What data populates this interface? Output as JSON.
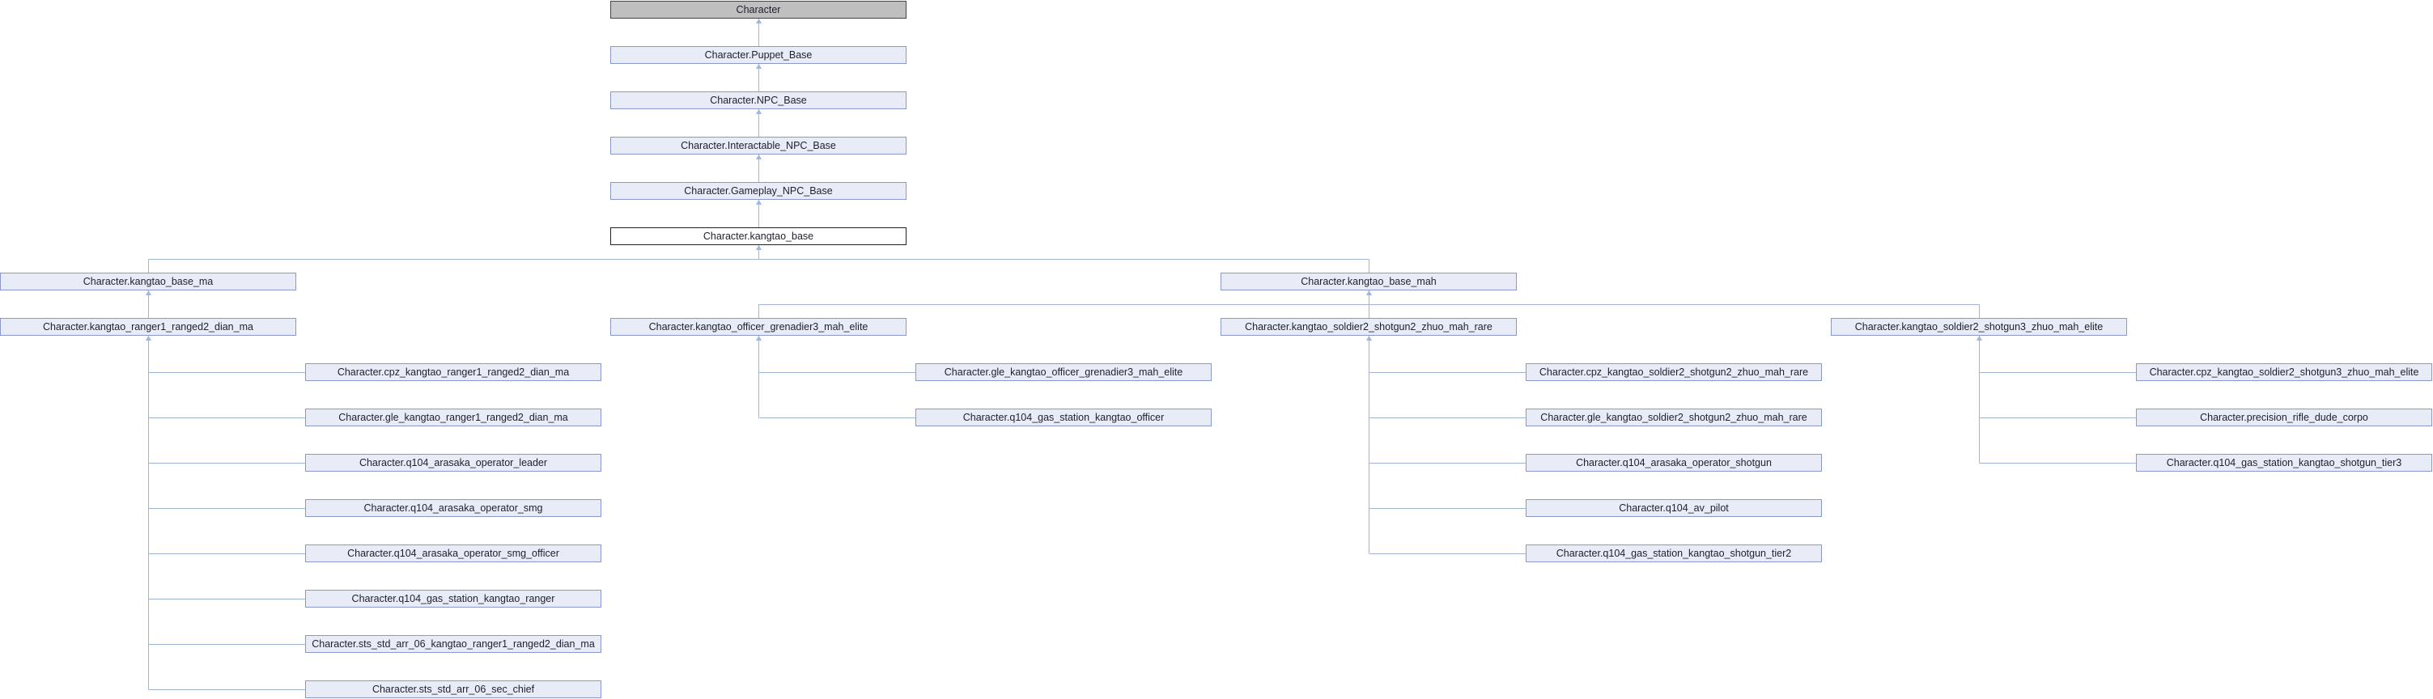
{
  "diagram": {
    "type": "class-inheritance-graph",
    "colors": {
      "node_fill": "#e8ecf6",
      "node_border": "#8a99c9",
      "edge": "#9fb6d8",
      "root_fill": "#bfbfbf",
      "focus_fill": "#ffffff"
    },
    "nodes": [
      {
        "id": "n0",
        "label": "Character",
        "style": "root"
      },
      {
        "id": "n1",
        "label": "Character.Puppet_Base"
      },
      {
        "id": "n2",
        "label": "Character.NPC_Base"
      },
      {
        "id": "n3",
        "label": "Character.Interactable_NPC_Base"
      },
      {
        "id": "n4",
        "label": "Character.Gameplay_NPC_Base"
      },
      {
        "id": "n5",
        "label": "Character.kangtao_base",
        "style": "focus"
      },
      {
        "id": "n6",
        "label": "Character.kangtao_base_ma"
      },
      {
        "id": "n7",
        "label": "Character.kangtao_base_mah"
      },
      {
        "id": "n8",
        "label": "Character.kangtao_ranger1_ranged2_dian_ma"
      },
      {
        "id": "n9",
        "label": "Character.kangtao_officer_grenadier3_mah_elite"
      },
      {
        "id": "n10",
        "label": "Character.kangtao_soldier2_shotgun2_zhuo_mah_rare"
      },
      {
        "id": "n11",
        "label": "Character.kangtao_soldier2_shotgun3_zhuo_mah_elite"
      },
      {
        "id": "n12",
        "label": "Character.cpz_kangtao_ranger1_ranged2_dian_ma"
      },
      {
        "id": "n13",
        "label": "Character.gle_kangtao_ranger1_ranged2_dian_ma"
      },
      {
        "id": "n14",
        "label": "Character.q104_arasaka_operator_leader"
      },
      {
        "id": "n15",
        "label": "Character.q104_arasaka_operator_smg"
      },
      {
        "id": "n16",
        "label": "Character.q104_arasaka_operator_smg_officer"
      },
      {
        "id": "n17",
        "label": "Character.q104_gas_station_kangtao_ranger"
      },
      {
        "id": "n18",
        "label": "Character.sts_std_arr_06_kangtao_ranger1_ranged2_dian_ma"
      },
      {
        "id": "n19",
        "label": "Character.sts_std_arr_06_sec_chief"
      },
      {
        "id": "n20",
        "label": "Character.gle_kangtao_officer_grenadier3_mah_elite"
      },
      {
        "id": "n21",
        "label": "Character.q104_gas_station_kangtao_officer"
      },
      {
        "id": "n22",
        "label": "Character.cpz_kangtao_soldier2_shotgun2_zhuo_mah_rare"
      },
      {
        "id": "n23",
        "label": "Character.gle_kangtao_soldier2_shotgun2_zhuo_mah_rare"
      },
      {
        "id": "n24",
        "label": "Character.q104_arasaka_operator_shotgun"
      },
      {
        "id": "n25",
        "label": "Character.q104_av_pilot"
      },
      {
        "id": "n26",
        "label": "Character.q104_gas_station_kangtao_shotgun_tier2"
      },
      {
        "id": "n27",
        "label": "Character.cpz_kangtao_soldier2_shotgun3_zhuo_mah_elite"
      },
      {
        "id": "n28",
        "label": "Character.precision_rifle_dude_corpo"
      },
      {
        "id": "n29",
        "label": "Character.q104_gas_station_kangtao_shotgun_tier3"
      }
    ],
    "edges": [
      [
        "n0",
        "n1"
      ],
      [
        "n1",
        "n2"
      ],
      [
        "n2",
        "n3"
      ],
      [
        "n3",
        "n4"
      ],
      [
        "n4",
        "n5"
      ],
      [
        "n5",
        "n6"
      ],
      [
        "n5",
        "n7"
      ],
      [
        "n6",
        "n8"
      ],
      [
        "n7",
        "n9"
      ],
      [
        "n7",
        "n10"
      ],
      [
        "n7",
        "n11"
      ],
      [
        "n8",
        "n12"
      ],
      [
        "n8",
        "n13"
      ],
      [
        "n8",
        "n14"
      ],
      [
        "n8",
        "n15"
      ],
      [
        "n8",
        "n16"
      ],
      [
        "n8",
        "n17"
      ],
      [
        "n8",
        "n18"
      ],
      [
        "n8",
        "n19"
      ],
      [
        "n9",
        "n20"
      ],
      [
        "n9",
        "n21"
      ],
      [
        "n10",
        "n22"
      ],
      [
        "n10",
        "n23"
      ],
      [
        "n10",
        "n24"
      ],
      [
        "n10",
        "n25"
      ],
      [
        "n10",
        "n26"
      ],
      [
        "n11",
        "n27"
      ],
      [
        "n11",
        "n28"
      ],
      [
        "n11",
        "n29"
      ]
    ]
  }
}
